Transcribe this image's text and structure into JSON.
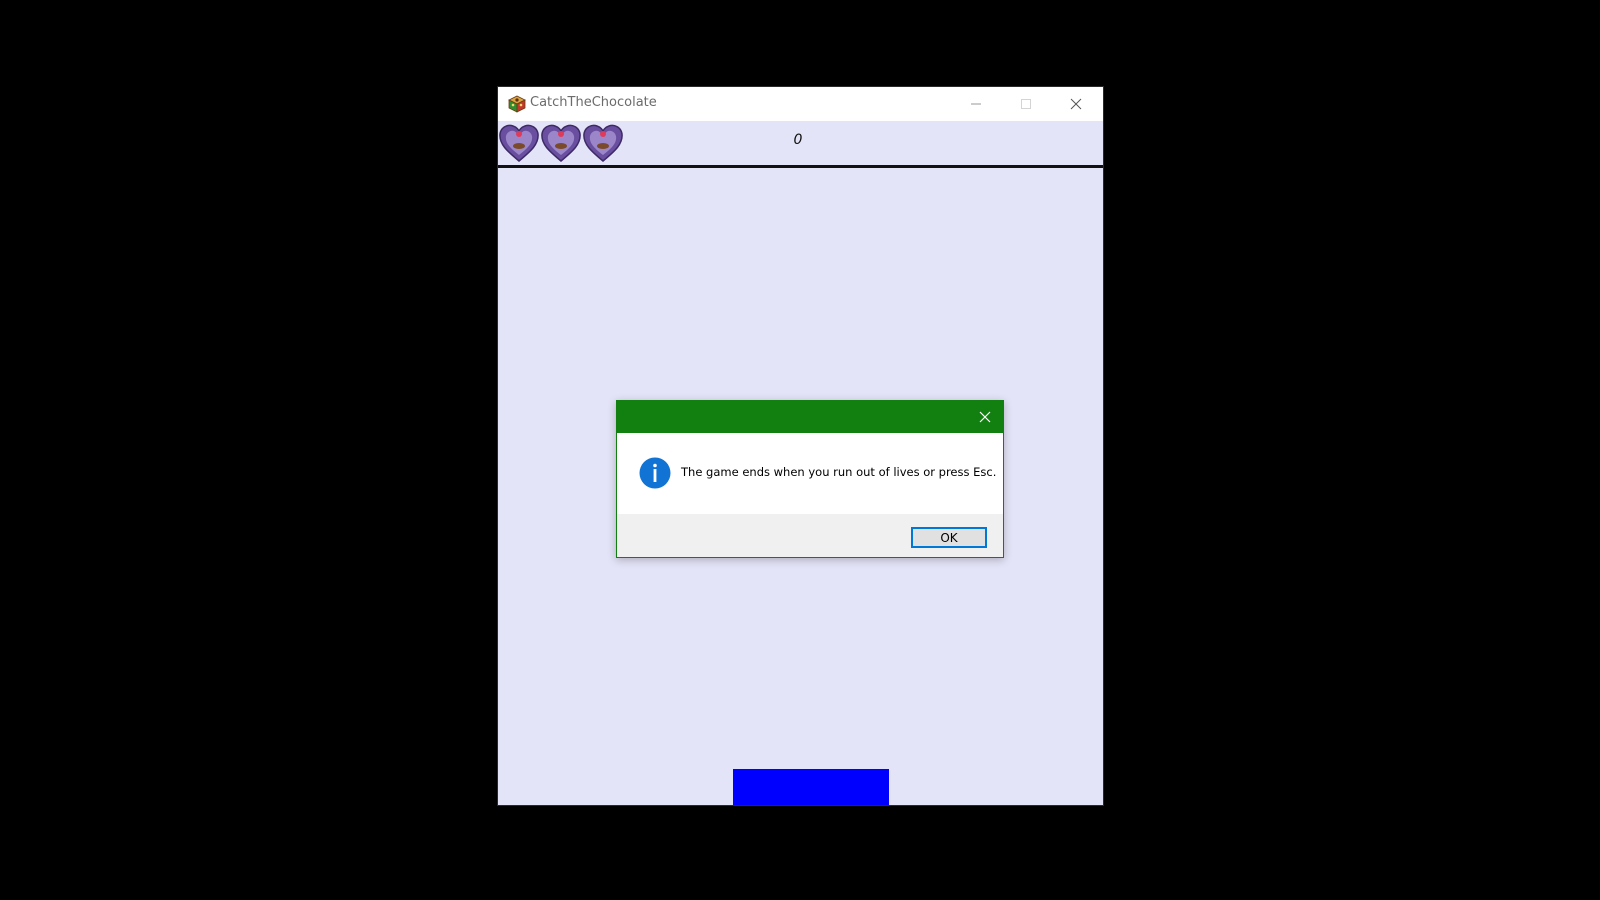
{
  "window": {
    "title": "CatchTheChocolate",
    "icon": "chocolate-box-icon",
    "controls": [
      "minimize-icon",
      "maximize-icon",
      "close-icon"
    ]
  },
  "hud": {
    "lives": 3,
    "life_icon": "heart-chocolate-icon",
    "score": "0"
  },
  "game": {
    "background_color": "#e4e4f8",
    "paddle_color": "#0000ff"
  },
  "dialog": {
    "title": "",
    "icon": "info-icon",
    "message": "The game ends when you run out of lives or press Esc.",
    "ok_label": "OK",
    "accent_color": "#118011"
  }
}
